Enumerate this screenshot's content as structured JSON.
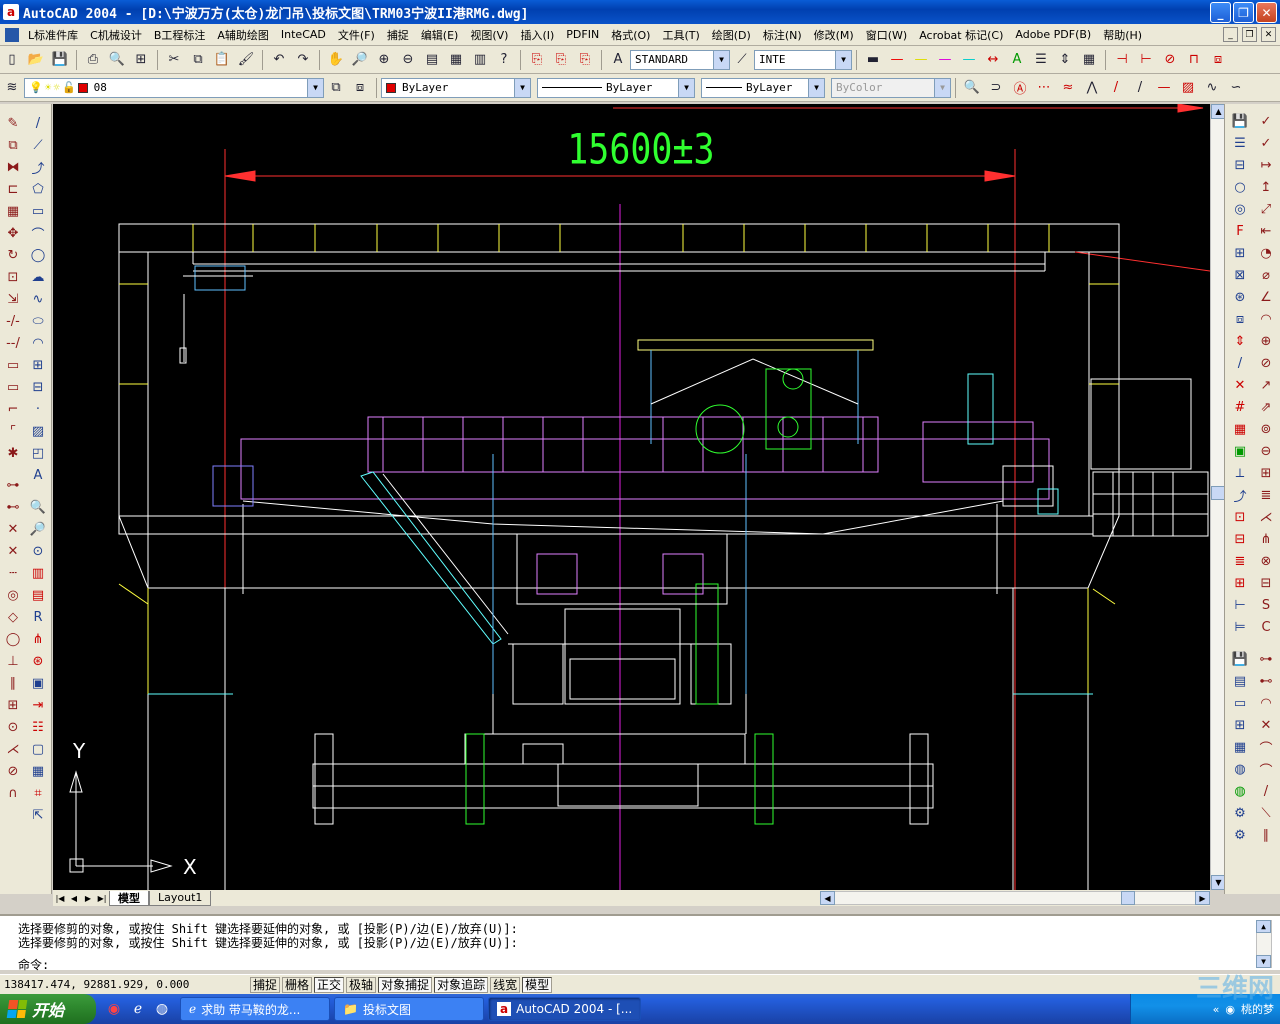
{
  "window": {
    "title": "AutoCAD 2004 - [D:\\宁波万方(太仓)龙门吊\\投标文图\\TRM03宁波II港RMG.dwg]",
    "app_icon_letter": "a"
  },
  "menubar": {
    "items": [
      "L标准件库",
      "C机械设计",
      "B工程标注",
      "A辅助绘图",
      "InteCAD",
      "文件(F)",
      "捕捉",
      "编辑(E)",
      "视图(V)",
      "插入(I)",
      "PDFIN",
      "格式(O)",
      "工具(T)",
      "绘图(D)",
      "标注(N)",
      "修改(M)",
      "窗口(W)",
      "Acrobat 标记(C)",
      "Adobe PDF(B)",
      "帮助(H)"
    ]
  },
  "toolbar1": {
    "text_style": "STANDARD",
    "dim_style": "INTE"
  },
  "toolbar2": {
    "layer": "08",
    "color": "ByLayer",
    "linetype": "ByLayer",
    "lineweight": "ByLayer",
    "plotstyle": "ByColor",
    "color_swatch": "#e00000"
  },
  "drawing": {
    "dimension_text": "15600±3",
    "ucs_x": "X",
    "ucs_y": "Y"
  },
  "layout_tabs": {
    "tabs": [
      "模型",
      "Layout1"
    ],
    "active": "模型"
  },
  "command": {
    "history": [
      "选择要修剪的对象, 或按住 Shift 键选择要延伸的对象, 或 [投影(P)/边(E)/放弃(U)]:",
      "选择要修剪的对象, 或按住 Shift 键选择要延伸的对象, 或 [投影(P)/边(E)/放弃(U)]:"
    ],
    "prompt": "命令:"
  },
  "statusbar": {
    "coords": "138417.474, 92881.929, 0.000",
    "toggles": [
      {
        "label": "捕捉",
        "on": false
      },
      {
        "label": "栅格",
        "on": false
      },
      {
        "label": "正交",
        "on": true
      },
      {
        "label": "极轴",
        "on": false
      },
      {
        "label": "对象捕捉",
        "on": true
      },
      {
        "label": "对象追踪",
        "on": true
      },
      {
        "label": "线宽",
        "on": false
      },
      {
        "label": "模型",
        "on": true
      }
    ]
  },
  "taskbar": {
    "start_label": "开始",
    "tasks": [
      {
        "label": "求助 带马鞍的龙...",
        "active": false
      },
      {
        "label": "投标文图",
        "active": false
      },
      {
        "label": "AutoCAD 2004 - [...",
        "active": true
      }
    ],
    "tray_text": "桃的梦"
  },
  "watermark": "三维网"
}
